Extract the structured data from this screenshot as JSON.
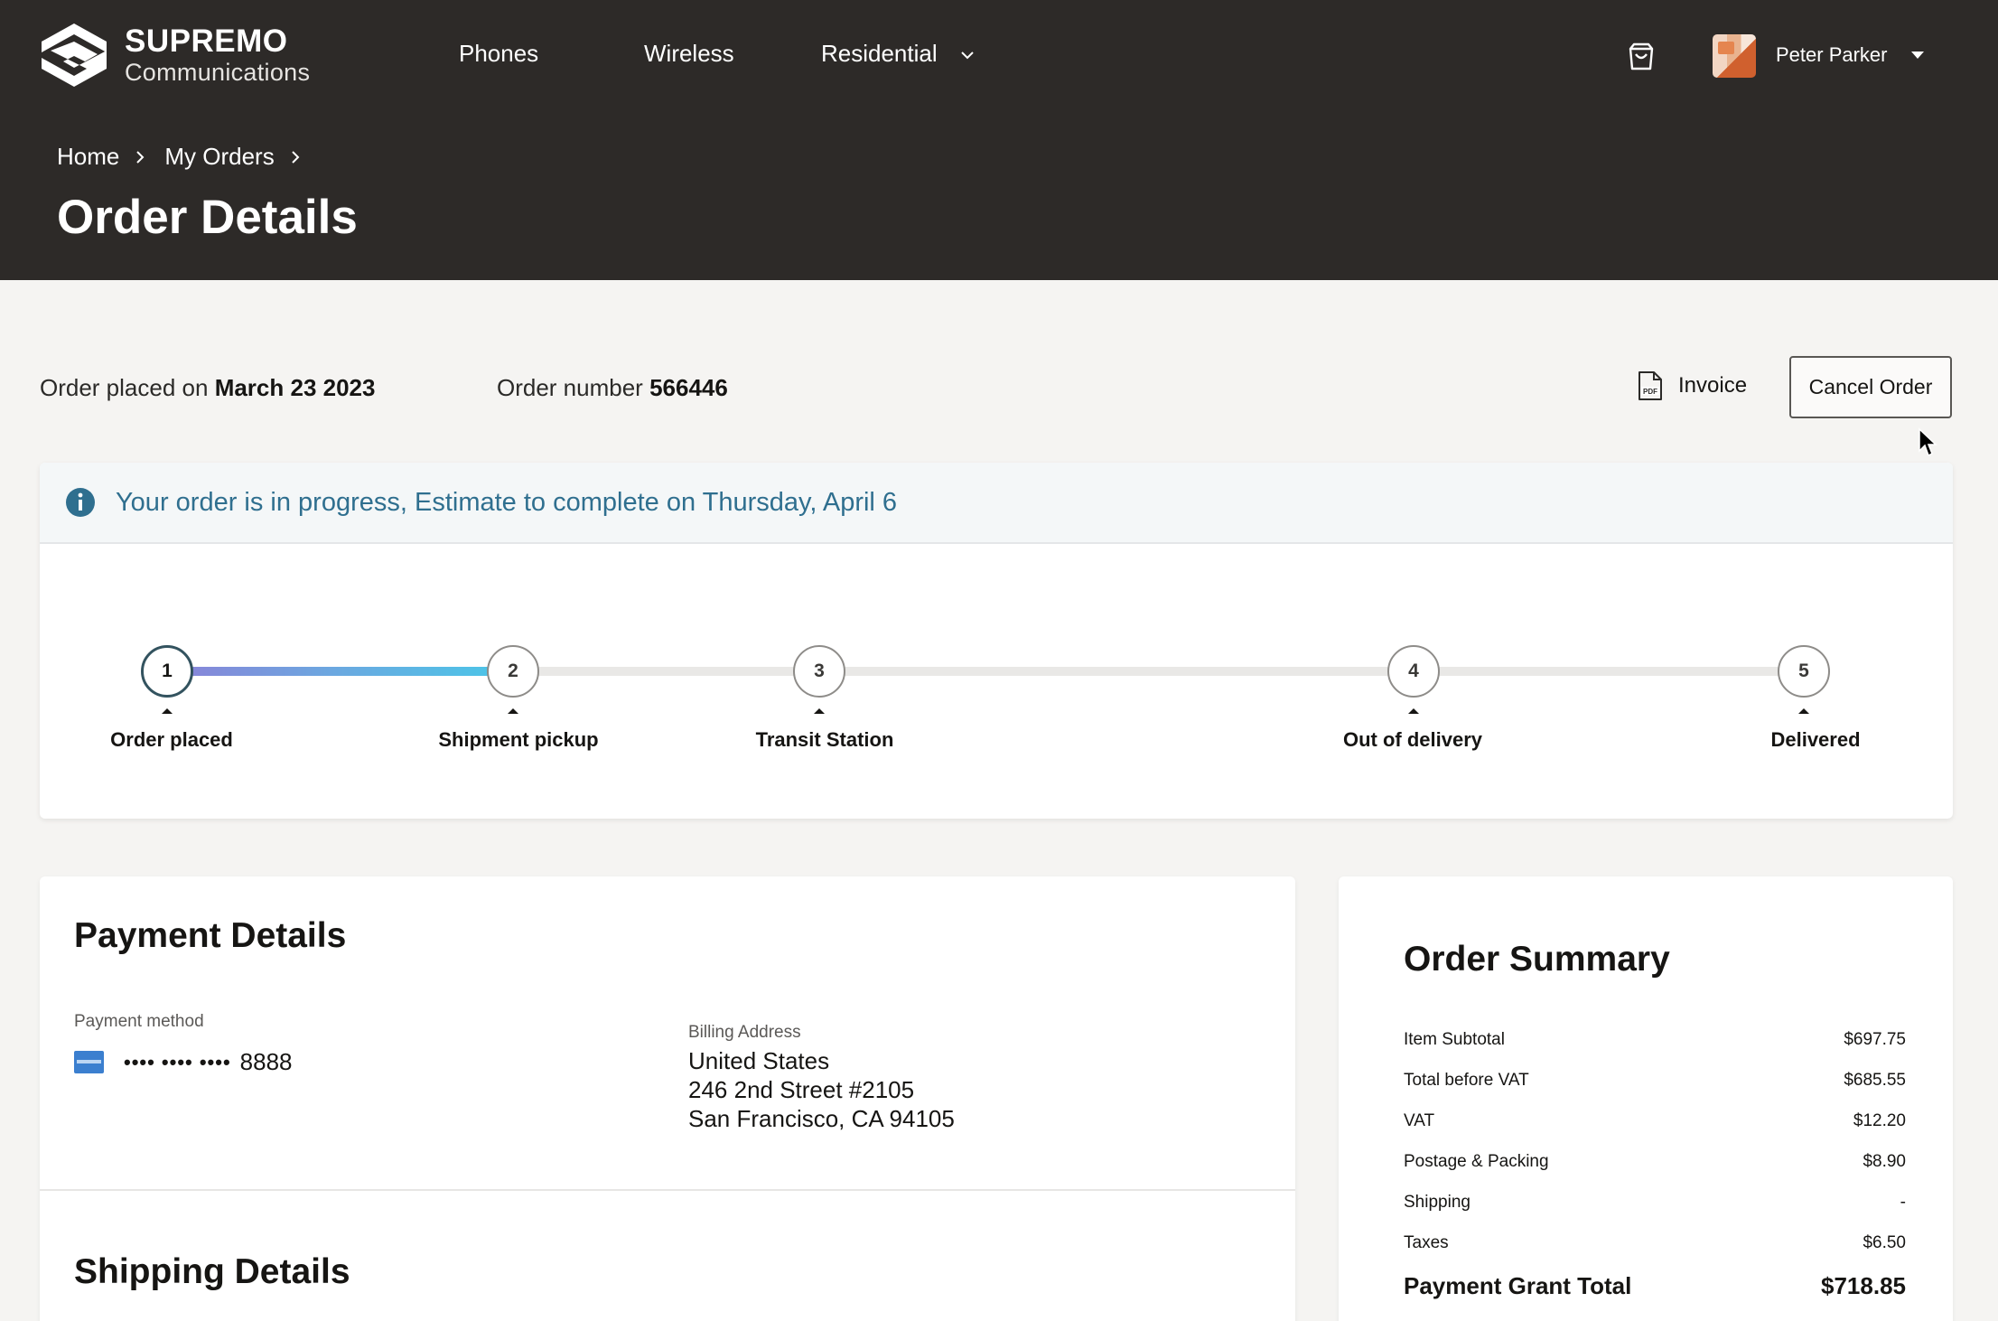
{
  "brand": {
    "name": "SUPREMO",
    "sub": "Communications"
  },
  "nav": {
    "phones": "Phones",
    "wireless": "Wireless",
    "residential": "Residential"
  },
  "user": {
    "name": "Peter Parker"
  },
  "breadcrumb": {
    "home": "Home",
    "orders": "My Orders"
  },
  "page": {
    "title": "Order Details"
  },
  "order": {
    "placed_label": "Order placed on",
    "placed_date": "March 23 2023",
    "number_label": "Order number",
    "number": "566446",
    "invoice_label": "Invoice",
    "cancel_label": "Cancel Order"
  },
  "status": {
    "banner": "Your order is in progress, Estimate to complete on Thursday, April 6",
    "steps": [
      {
        "num": "1",
        "label": "Order placed"
      },
      {
        "num": "2",
        "label": "Shipment pickup"
      },
      {
        "num": "3",
        "label": "Transit Station"
      },
      {
        "num": "4",
        "label": "Out of delivery"
      },
      {
        "num": "5",
        "label": "Delivered"
      }
    ]
  },
  "payment": {
    "title": "Payment Details",
    "method_label": "Payment method",
    "card_mask": "•••• •••• ••••",
    "card_last4": "8888",
    "billing_label": "Billing Address",
    "billing_lines": [
      "United States",
      "246 2nd Street #2105",
      "San Francisco, CA 94105"
    ]
  },
  "shipping": {
    "title": "Shipping Details"
  },
  "summary": {
    "title": "Order Summary",
    "rows": [
      {
        "label": "Item Subtotal",
        "value": "$697.75"
      },
      {
        "label": "Total before VAT",
        "value": "$685.55"
      },
      {
        "label": "VAT",
        "value": "$12.20"
      },
      {
        "label": "Postage & Packing",
        "value": "$8.90"
      },
      {
        "label": "Shipping",
        "value": "-"
      },
      {
        "label": "Taxes",
        "value": "$6.50"
      }
    ],
    "total_label": "Payment Grant Total",
    "total_value": "$718.85"
  },
  "colors": {
    "header_bg": "#2d2a28",
    "banner_text": "#2f6f8f",
    "page_bg": "#f5f4f2"
  }
}
